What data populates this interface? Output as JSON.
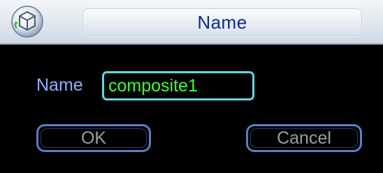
{
  "window": {
    "title": "Name",
    "icon": "sphere-cube-icon"
  },
  "form": {
    "name_label": "Name",
    "name_value": "composite1"
  },
  "buttons": {
    "ok_label": "OK",
    "cancel_label": "Cancel"
  },
  "colors": {
    "title_text": "#0d2a8a",
    "label_text": "#8fb0ff",
    "input_text": "#3cff2e",
    "input_border": "#5fd8e0",
    "button_border": "#5b7fc0",
    "button_text": "#9a9fa8",
    "background": "#000000"
  }
}
